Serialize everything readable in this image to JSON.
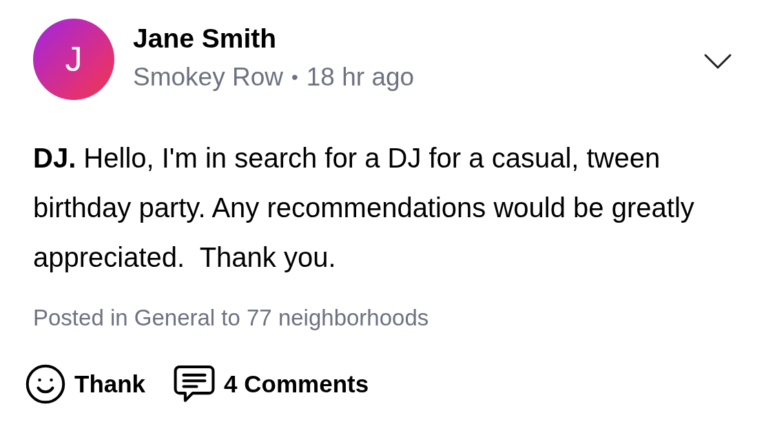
{
  "post": {
    "author": {
      "name": "Jane Smith",
      "initial": "J"
    },
    "neighborhood": "Smokey Row",
    "separator": "•",
    "time": "18 hr ago",
    "body": "**DJ.** Hello, I'm in search for a DJ for a casual, tween birthday party. Any recommendations would be greatly appreciated.  Thank you.",
    "posted_in": "Posted in General to 77 neighborhoods",
    "actions": [
      {
        "kind": "thank",
        "label": "Thank"
      },
      {
        "kind": "comments",
        "label": "4 Comments"
      }
    ]
  }
}
